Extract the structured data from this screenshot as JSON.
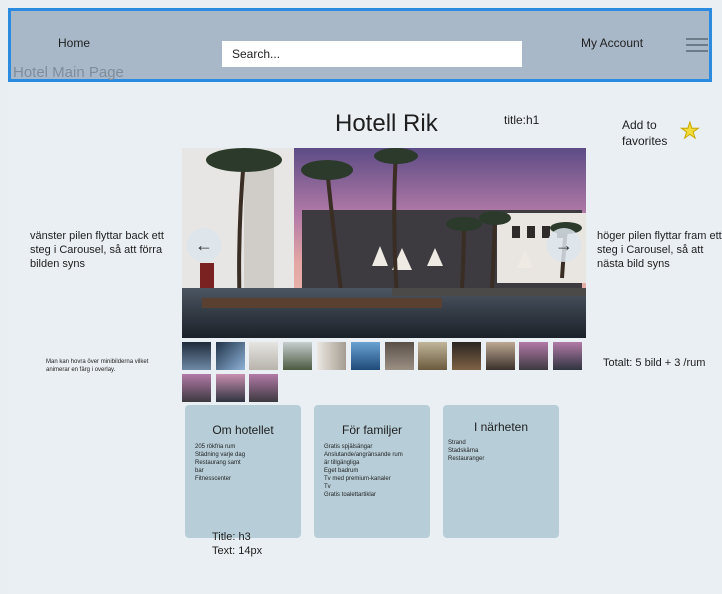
{
  "header": {
    "home_label": "Home",
    "page_label": "Hotel Main Page",
    "search_placeholder": "Search...",
    "account_label": "My Account",
    "menu_icon": "hamburger-icon"
  },
  "hotel": {
    "title": "Hotell Rik",
    "title_note": "title:h1",
    "favorite_label_line1": "Add to",
    "favorite_label_line2": "favorites",
    "favorite_icon": "star-icon"
  },
  "carousel": {
    "prev_glyph": "←",
    "next_glyph": "→",
    "left_note": "vänster pilen flyttar back ett steg i Carousel, så att förra bilden syns",
    "right_note": "höger pilen flyttar fram ett steg i Carousel, så att nästa bild syns",
    "thumbnail_note": "Man kan hovra över minibilderna vilket animerar en färg i overlay.",
    "total_note": "Totalt: 5 bild + 3 /rum"
  },
  "cards": [
    {
      "title": "Om hotellet",
      "items": [
        "205 rökfria rum",
        "Städning varje dag",
        "Restaurang samt",
        "bar",
        "Fitnesscenter"
      ]
    },
    {
      "title": "För familjer",
      "items": [
        "Gratis spjälsängar",
        "Anslutande/angränsande rum",
        "är tillgängliga",
        "Eget badrum",
        "Tv med premium-kanaler",
        "Tv",
        "Gratis toalettartiklar"
      ]
    },
    {
      "title": "I närheten",
      "items": [
        "Strand",
        "Stadskärna",
        "Restauranger"
      ]
    }
  ],
  "card_note_line1": "Title: h3",
  "card_note_line2": "Text: 14px",
  "colors": {
    "header_bg": "#a9b8c8",
    "header_border": "#2a8be0",
    "card_bg": "#b7ced8",
    "star": "#f2dc3a"
  }
}
